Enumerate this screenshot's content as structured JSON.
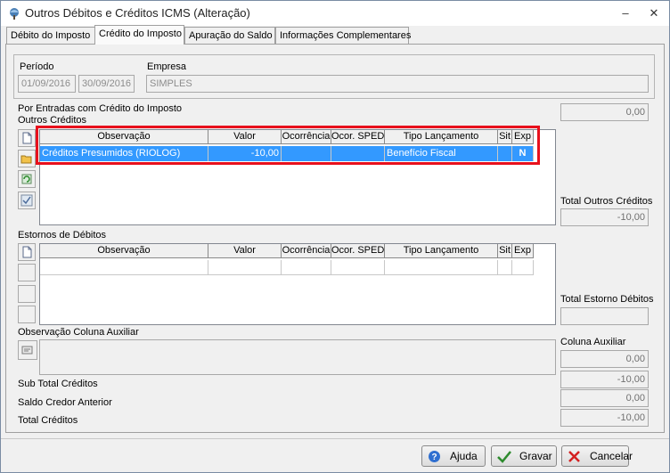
{
  "window": {
    "title": "Outros Débitos e Créditos ICMS (Alteração)",
    "minimize": "–",
    "close": "✕"
  },
  "tabs": [
    {
      "label": "Débito do Imposto"
    },
    {
      "label": "Crédito do Imposto"
    },
    {
      "label": "Apuração do Saldo"
    },
    {
      "label": "Informações Complementares"
    }
  ],
  "header": {
    "periodo_label": "Período",
    "periodo_inicio": "01/09/2016",
    "periodo_fim": "30/09/2016",
    "empresa_label": "Empresa",
    "empresa_value": "SIMPLES"
  },
  "por_entradas": {
    "label": "Por Entradas com Crédito do Imposto",
    "value": "0,00"
  },
  "outros_creditos": {
    "label": "Outros Créditos",
    "columns": [
      "Observação",
      "Valor",
      "Ocorrência",
      "Ocor. SPED",
      "Tipo Lançamento",
      "Sit",
      "Exp"
    ],
    "rows": [
      {
        "observacao": "Créditos Presumidos (RIOLOG)",
        "valor": "-10,00",
        "ocorrencia": "",
        "ocor_sped": "",
        "tipo": "Benefício Fiscal",
        "sit": "",
        "exp": "N"
      }
    ],
    "total_label": "Total Outros Créditos",
    "total_value": "-10,00"
  },
  "estornos": {
    "label": "Estornos de Débitos",
    "columns": [
      "Observação",
      "Valor",
      "Ocorrência",
      "Ocor. SPED",
      "Tipo Lançamento",
      "Sit",
      "Exp"
    ],
    "total_label": "Total Estorno Débitos",
    "total_value": ""
  },
  "obs_aux": {
    "label": "Observação Coluna Auxiliar"
  },
  "coluna_aux": {
    "label": "Coluna Auxiliar",
    "value": "0,00"
  },
  "totais": {
    "sub_total_label": "Sub Total Créditos",
    "sub_total_value": "-10,00",
    "saldo_label": "Saldo Credor Anterior",
    "saldo_value": "0,00",
    "total_label": "Total Créditos",
    "total_value": "-10,00"
  },
  "buttons": {
    "ajuda": "Ajuda",
    "gravar": "Gravar",
    "cancelar": "Cancelar"
  },
  "colors": {
    "selection": "#3399ff",
    "highlight": "#e8101c"
  }
}
